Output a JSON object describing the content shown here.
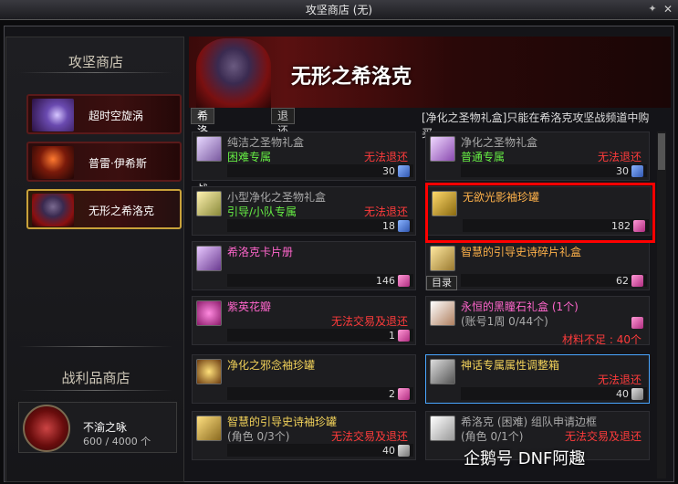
{
  "window": {
    "title": "攻坚商店 (无)"
  },
  "left": {
    "shop_title": "攻坚商店",
    "shops": [
      {
        "label": "超时空旋涡"
      },
      {
        "label": "普雷·伊希斯"
      },
      {
        "label": "无形之希洛克"
      }
    ],
    "trophy_title": "战利品商店",
    "trophy": {
      "name": "不渝之咏",
      "count": "600 / 4000 个"
    }
  },
  "banner": {
    "title": "无形之希洛克"
  },
  "tabs": [
    {
      "label": "希洛克攻坚战"
    },
    {
      "label": "退还"
    }
  ],
  "notice": "[净化之圣物礼盒]只能在希洛克攻坚战频道中购买。",
  "items": [
    {
      "name": "纯洁之圣物礼盒",
      "sub": "困难专属",
      "warn": "无法退还",
      "price": "30"
    },
    {
      "name": "净化之圣物礼盒",
      "sub": "普通专属",
      "warn": "无法退还",
      "price": "30"
    },
    {
      "name": "小型净化之圣物礼盒",
      "sub": "引导/小队专属",
      "warn": "无法退还",
      "price": "18"
    },
    {
      "name": "无欲光影袖珍罐",
      "sub": "",
      "warn": "",
      "price": "182"
    },
    {
      "name": "希洛克卡片册",
      "sub": "",
      "warn": "",
      "price": "146"
    },
    {
      "name": "智慧的引导史诗碎片礼盒",
      "sub": "",
      "warn": "",
      "price": "62"
    },
    {
      "name": "紫英花瓣",
      "sub": "",
      "warn": "无法交易及退还",
      "price": "1"
    },
    {
      "name": "永恒的黑瞳石礼盒 (1个)",
      "sub": "(账号1周 0/44个)",
      "warn": "材料不足 : 40个",
      "price": ""
    },
    {
      "name": "净化之邪念袖珍罐",
      "sub": "",
      "warn": "",
      "price": "2"
    },
    {
      "name": "神话专属属性调整箱",
      "sub": "",
      "warn": "无法退还",
      "price": "40"
    },
    {
      "name": "智慧的引导史诗袖珍罐",
      "sub": "(角色 0/3个)",
      "warn": "无法交易及退还",
      "price": "40"
    },
    {
      "name": "希洛克 (困难) 组队申请边框",
      "sub": "(角色 0/1个)",
      "warn": "无法交易及退还",
      "price": ""
    }
  ],
  "mulu": "目录",
  "watermark": "企鹅号 DNF阿趣",
  "colors": {
    "highlight": "#ff0000",
    "warn": "#ff3b3b",
    "frame_gold": "#c9a23a"
  }
}
